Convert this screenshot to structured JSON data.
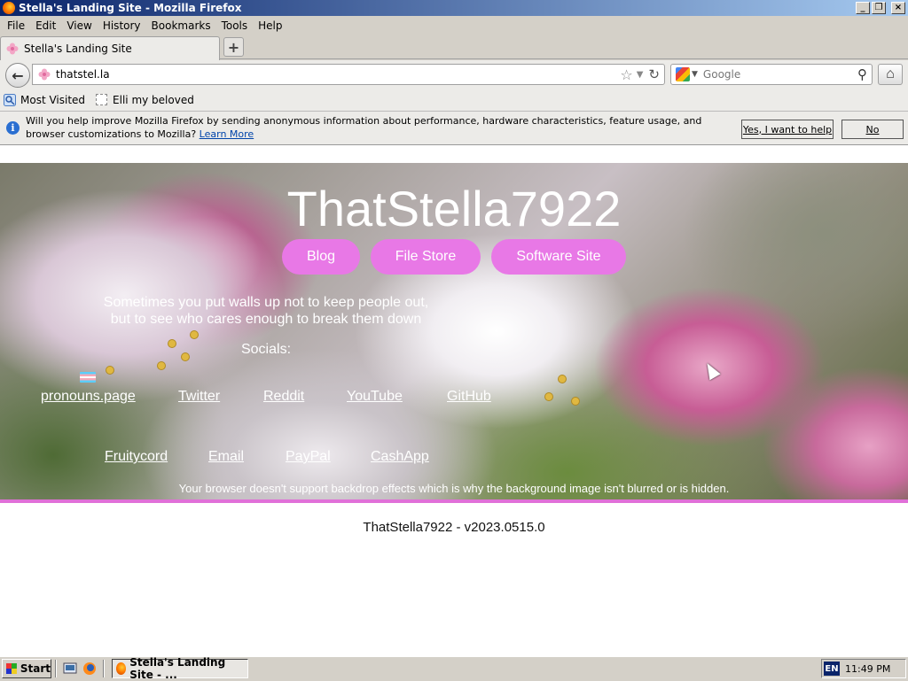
{
  "window": {
    "title": "Stella's Landing Site - Mozilla Firefox",
    "controls": [
      "_",
      "❐",
      "×"
    ]
  },
  "menu": [
    "File",
    "Edit",
    "View",
    "History",
    "Bookmarks",
    "Tools",
    "Help"
  ],
  "tab": {
    "title": "Stella's Landing Site",
    "new_tab": "+"
  },
  "nav": {
    "url": "thatstel.la",
    "search_placeholder": "Google"
  },
  "bookmarks": [
    "Most Visited",
    "Elli my beloved"
  ],
  "notification": {
    "message": "Will you help improve Mozilla Firefox by sending anonymous information about performance, hardware characteristics, feature usage, and browser customizations to Mozilla?",
    "link": "Learn More",
    "yes_label": "Yes, I want to help",
    "no_label": "No"
  },
  "page": {
    "title": "ThatStella7922",
    "nav_buttons": [
      "Blog",
      "File Store",
      "Software Site"
    ],
    "quote_line1": "Sometimes you put walls up not to keep people out,",
    "quote_line2": "but to see who cares enough to break them down",
    "socials_label": "Socials:",
    "socials_row1": [
      "pronouns.page",
      "Twitter",
      "Reddit",
      "YouTube",
      "GitHub"
    ],
    "socials_row2": [
      "Fruitycord",
      "Email",
      "PayPal",
      "CashApp"
    ],
    "notice": "Your browser doesn't support backdrop effects which is why the background image isn't blurred or is hidden.",
    "footer": "ThatStella7922 - v2023.0515.0",
    "accent_color": "#e878e6"
  },
  "taskbar": {
    "start": "Start",
    "task": "Stella's Landing Site - ...",
    "lang": "EN",
    "clock": "11:49 PM"
  }
}
